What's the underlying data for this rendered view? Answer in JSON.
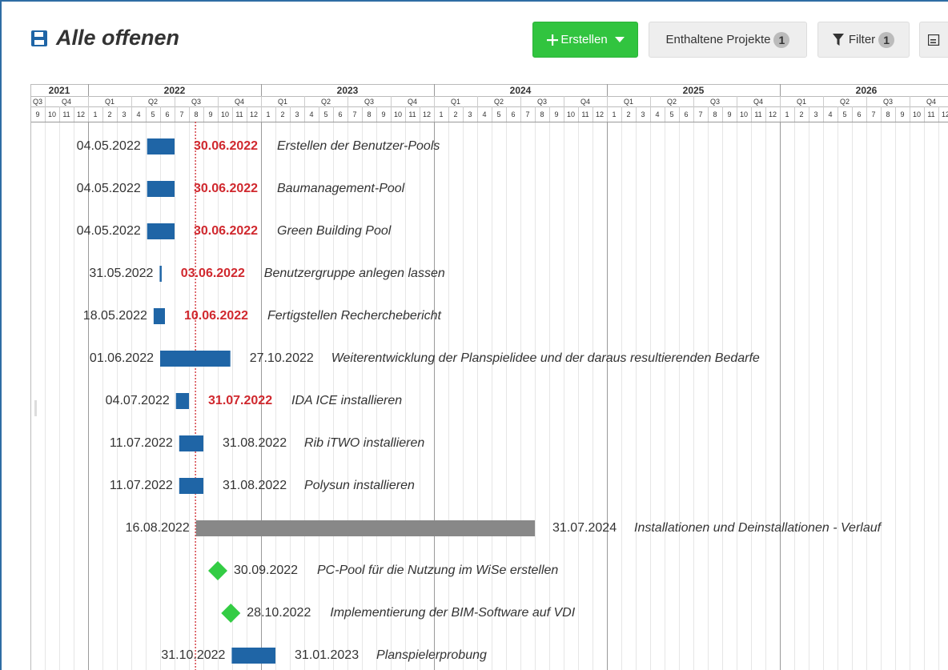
{
  "header": {
    "title": "Alle offenen",
    "buttons": {
      "create": {
        "label": "Erstellen"
      },
      "projects": {
        "label": "Enthaltene Projekte",
        "badge": "1"
      },
      "filter": {
        "label": "Filter",
        "badge": "1"
      }
    }
  },
  "colors": {
    "bar": "#1f65a6",
    "long_bar": "#888888",
    "milestone": "#33cc44",
    "overdue_text": "#d0282e",
    "today_line": "#d0282e"
  },
  "timeline": {
    "years": [
      "2021",
      "2022",
      "2023",
      "2024",
      "2025",
      "2026"
    ],
    "quarters": [
      "Q3",
      "Q4",
      "Q1",
      "Q2",
      "Q3",
      "Q4",
      "Q1",
      "Q2",
      "Q3",
      "Q4",
      "Q1",
      "Q2",
      "Q3",
      "Q4",
      "Q1",
      "Q2",
      "Q3",
      "Q4",
      "Q1",
      "Q2",
      "Q3",
      "Q4"
    ],
    "months": [
      "9",
      "10",
      "11",
      "12",
      "1",
      "2",
      "3",
      "4",
      "5",
      "6",
      "7",
      "8",
      "9",
      "10",
      "11",
      "12",
      "1",
      "2",
      "3",
      "4",
      "5",
      "6",
      "7",
      "8",
      "9",
      "10",
      "11",
      "12",
      "1",
      "2",
      "3",
      "4",
      "5",
      "6",
      "7",
      "8",
      "9",
      "10",
      "11",
      "12",
      "1",
      "2",
      "3",
      "4",
      "5",
      "6",
      "7",
      "8",
      "9",
      "10",
      "11",
      "12",
      "1",
      "2",
      "3",
      "4",
      "5",
      "6",
      "7",
      "8",
      "9",
      "10",
      "11",
      "12"
    ],
    "today": "2022-08-15"
  },
  "tasks": [
    {
      "start": "04.05.2022",
      "end": "30.06.2022",
      "name": "Erstellen der Benutzer-Pools",
      "type": "bar",
      "overdue": true
    },
    {
      "start": "04.05.2022",
      "end": "30.06.2022",
      "name": "Baumanagement-Pool",
      "type": "bar",
      "overdue": true
    },
    {
      "start": "04.05.2022",
      "end": "30.06.2022",
      "name": "Green Building Pool",
      "type": "bar",
      "overdue": true
    },
    {
      "start": "31.05.2022",
      "end": "03.06.2022",
      "name": "Benutzergruppe anlegen lassen",
      "type": "bar",
      "overdue": true
    },
    {
      "start": "18.05.2022",
      "end": "10.06.2022",
      "name": "Fertigstellen Recherchebericht",
      "type": "bar",
      "overdue": true
    },
    {
      "start": "01.06.2022",
      "end": "27.10.2022",
      "name": "Weiterentwicklung der Planspielidee und der daraus resultierenden Bedarfe",
      "type": "bar",
      "overdue": false
    },
    {
      "start": "04.07.2022",
      "end": "31.07.2022",
      "name": "IDA ICE installieren",
      "type": "bar",
      "overdue": true
    },
    {
      "start": "11.07.2022",
      "end": "31.08.2022",
      "name": "Rib iTWO installieren",
      "type": "bar",
      "overdue": false
    },
    {
      "start": "11.07.2022",
      "end": "31.08.2022",
      "name": "Polysun installieren",
      "type": "bar",
      "overdue": false
    },
    {
      "start": "16.08.2022",
      "end": "31.07.2024",
      "name": "Installationen und Deinstallationen - Verlauf",
      "type": "long",
      "overdue": false
    },
    {
      "start": "",
      "end": "30.09.2022",
      "name": "PC-Pool für die Nutzung im WiSe erstellen",
      "type": "milestone",
      "overdue": false
    },
    {
      "start": "",
      "end": "28.10.2022",
      "name": "Implementierung der BIM-Software auf VDI",
      "type": "milestone",
      "overdue": false
    },
    {
      "start": "31.10.2022",
      "end": "31.01.2023",
      "name": "Planspielerprobung",
      "type": "bar",
      "overdue": false
    }
  ]
}
